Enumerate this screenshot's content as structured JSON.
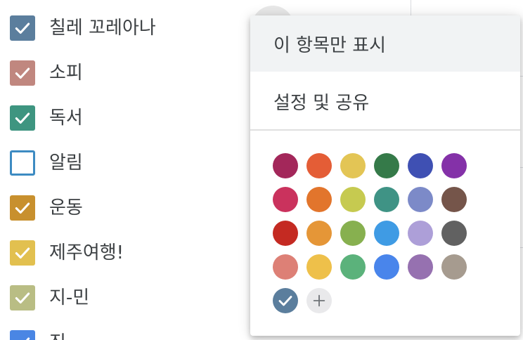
{
  "calendars": [
    {
      "label": "칠레 꼬레아나",
      "color": "#5b7e9d",
      "checked": true
    },
    {
      "label": "소피",
      "color": "#c0877f",
      "checked": true
    },
    {
      "label": "독서",
      "color": "#3e9580",
      "checked": true
    },
    {
      "label": "알림",
      "color": "#3d8bc2",
      "checked": false
    },
    {
      "label": "운동",
      "color": "#c8902e",
      "checked": true
    },
    {
      "label": "제주여행!",
      "color": "#e2c04f",
      "checked": true
    },
    {
      "label": "지-민",
      "color": "#b9bd84",
      "checked": true
    },
    {
      "label": "진",
      "color": "#4a86e4",
      "checked": true
    }
  ],
  "menu": {
    "show_only_this": "이 항목만 표시",
    "settings_and_sharing": "설정 및 공유"
  },
  "palette": [
    [
      "#a3275a",
      "#e45d36",
      "#e3c555",
      "#357a49",
      "#3f50b3",
      "#8431a8"
    ],
    [
      "#ca325d",
      "#e2752c",
      "#c6ca50",
      "#3f9385",
      "#7c8ac8",
      "#75554a"
    ],
    [
      "#c42a22",
      "#e59637",
      "#87b04f",
      "#3f9be4",
      "#ad9fd8",
      "#616161"
    ],
    [
      "#dd8076",
      "#eec04a",
      "#5bb27b",
      "#4985eb",
      "#9671b0",
      "#a69b8f"
    ]
  ],
  "selected_color": "#5b7e9d",
  "add_color_icon": "plus-icon"
}
